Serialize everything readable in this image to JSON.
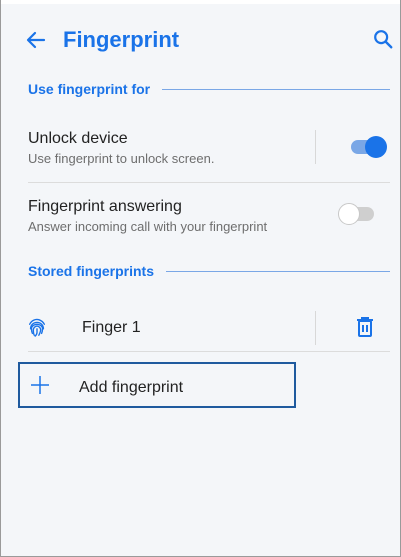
{
  "header": {
    "title": "Fingerprint",
    "back_icon": "arrow-left-icon",
    "search_icon": "search-icon"
  },
  "sections": {
    "use_for": {
      "label": "Use fingerprint for",
      "items": [
        {
          "title": "Unlock device",
          "subtitle": "Use fingerprint to unlock screen.",
          "enabled": true
        },
        {
          "title": "Fingerprint answering",
          "subtitle": "Answer incoming call with your fingerprint",
          "enabled": false
        }
      ]
    },
    "stored": {
      "label": "Stored fingerprints",
      "fingerprints": [
        {
          "name": "Finger 1",
          "icon": "fingerprint-icon",
          "action_icon": "trash-icon"
        }
      ],
      "add_label": "Add fingerprint",
      "add_icon": "plus-icon"
    }
  },
  "colors": {
    "accent": "#1a73e8",
    "accent_light": "#7aa7e6",
    "background": "#f4f6f9",
    "focus_border": "#1f5a9e"
  }
}
